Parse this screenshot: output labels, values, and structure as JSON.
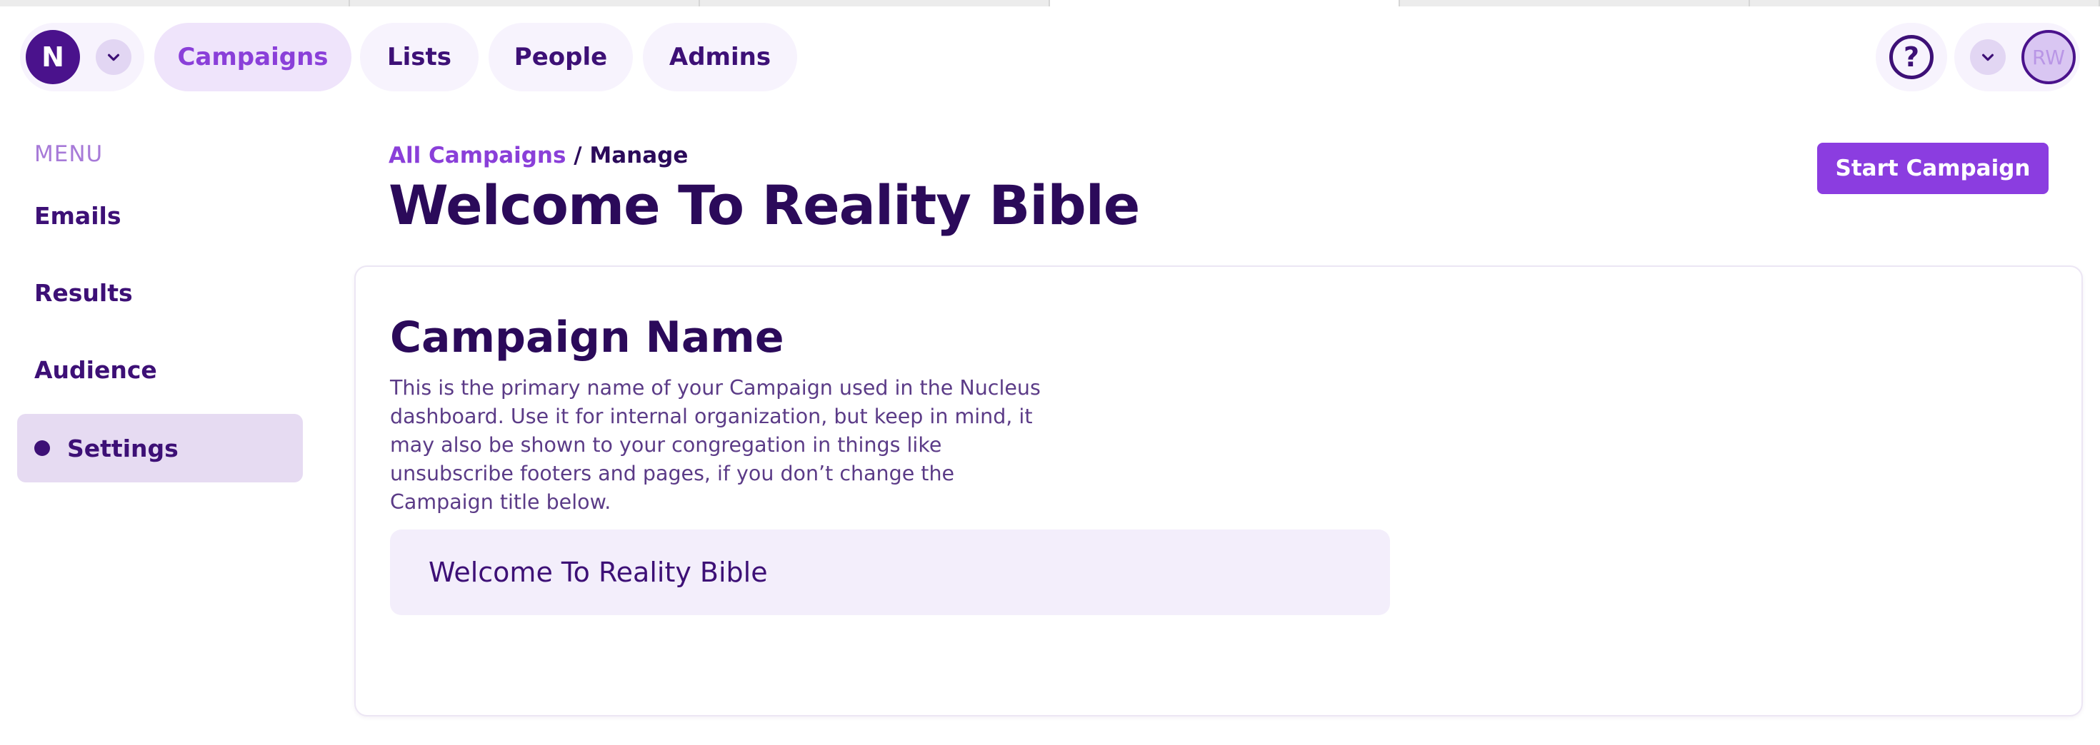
{
  "browser": {
    "tab_count": 6
  },
  "topnav": {
    "logo_letter": "N",
    "tabs": [
      {
        "label": "Campaigns",
        "active": true
      },
      {
        "label": "Lists",
        "active": false
      },
      {
        "label": "People",
        "active": false
      },
      {
        "label": "Admins",
        "active": false
      }
    ],
    "help_glyph": "?",
    "avatar_initials": "RW"
  },
  "sidebar": {
    "menu_label": "MENU",
    "items": [
      {
        "label": "Emails",
        "active": false
      },
      {
        "label": "Results",
        "active": false
      },
      {
        "label": "Audience",
        "active": false
      },
      {
        "label": "Settings",
        "active": true
      }
    ]
  },
  "header": {
    "breadcrumb_link": "All Campaigns",
    "breadcrumb_separator": " / ",
    "breadcrumb_current": "Manage",
    "title": "Welcome To Reality Bible",
    "start_button_label": "Start Campaign"
  },
  "card": {
    "section_title": "Campaign Name",
    "description": "This is the primary name of your Campaign used in the Nucleus dashboard. Use it for internal organization, but keep in mind, it may also be shown to your congregation in things like unsubscribe footers and pages, if you don’t change the Campaign title below.",
    "name_value": "Welcome To Reality Bible"
  },
  "colors": {
    "brand_dark": "#4a128c",
    "text_dark": "#2b0a5a",
    "accent": "#8b3de0",
    "pill_bg": "#f7f3fd",
    "active_pill_bg": "#efe4fb",
    "sidebar_active_bg": "#e6dbf2",
    "field_bg": "#f3eefb"
  },
  "icons": {
    "logo": "nucleus-logo-icon",
    "dropdown": "chevron-down-icon",
    "help": "help-circle-icon",
    "active_marker": "active-dot-icon"
  }
}
